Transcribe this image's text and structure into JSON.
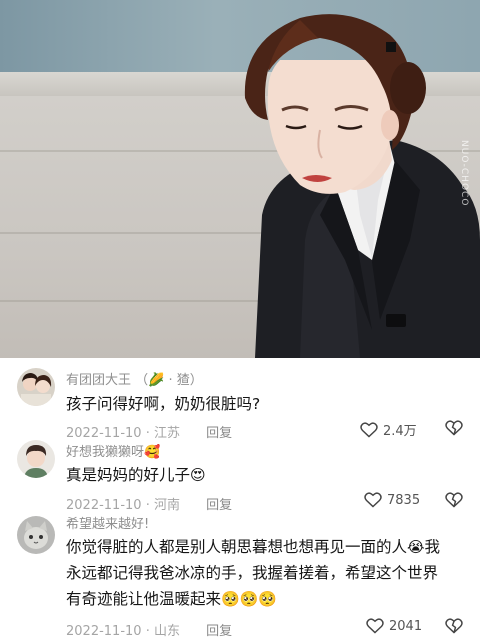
{
  "video": {
    "watermark": "NUO-CHOCO"
  },
  "comments": [
    {
      "username": "有团团大王",
      "badge": "（🌽 · 猹）",
      "text": "孩子问得好啊，奶奶很脏吗?",
      "date": "2022-11-10",
      "location": "江苏",
      "reply_label": "回复",
      "likes": "2.4万",
      "avatar_icon": "couple-avatar"
    },
    {
      "username": "好想我獭獭呀",
      "badge_emoji": "🥰",
      "text": "真是妈妈的好儿子",
      "text_emoji": "😍",
      "date": "2022-11-10",
      "location": "河南",
      "reply_label": "回复",
      "likes": "7835",
      "avatar_icon": "boy-avatar"
    },
    {
      "username": "希望越来越好!",
      "text_line1": "你觉得脏的人都是别人朝思暮想也想再见一面的人",
      "text_line1_emoji": "😭",
      "text_line1_tail": "我",
      "text_line2": "永远都记得我爸冰凉的手，我握着搓着，希望这个世界",
      "text_line3": "有奇迹能让他温暖起来",
      "text_line3_emoji": "🥺🥺🥺",
      "date": "2022-11-10",
      "location": "山东",
      "reply_label": "回复",
      "likes": "2041",
      "avatar_icon": "cat-avatar"
    }
  ],
  "colors": {
    "text": "#161616",
    "secondary": "#8f8f8f",
    "meta": "#a5a5a5"
  }
}
